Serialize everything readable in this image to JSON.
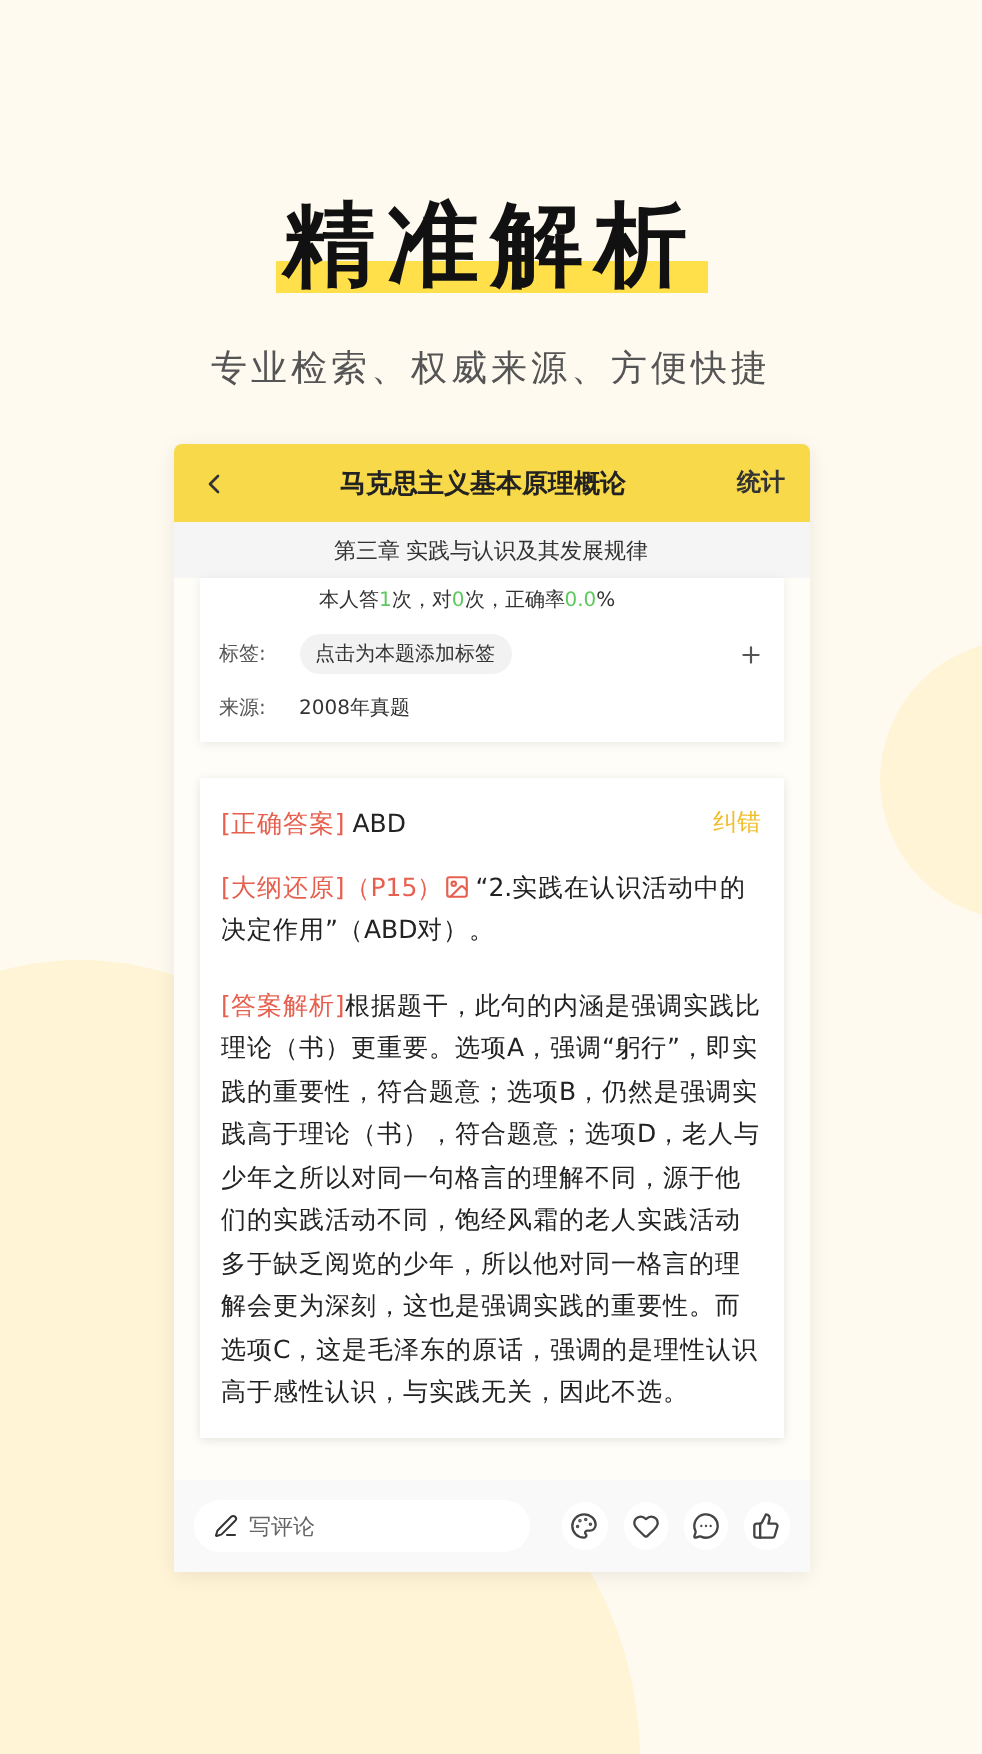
{
  "headline": "精准解析",
  "subtitle": "专业检索、权威来源、方便快捷",
  "header": {
    "title": "马克思主义基本原理概论",
    "action": "统计"
  },
  "chapter": "第三章 实践与认识及其发展规律",
  "stats": [
    {
      "text": "本人答",
      "highlight": false
    },
    {
      "text": "1",
      "highlight": true
    },
    {
      "text": "次，对",
      "highlight": false
    },
    {
      "text": "0",
      "highlight": true
    },
    {
      "text": "次，正确率",
      "highlight": false
    },
    {
      "text": "0.0",
      "highlight": true
    },
    {
      "text": "%",
      "highlight": false
    }
  ],
  "tag_row": {
    "label": "标签:",
    "chip": "点击为本题添加标签"
  },
  "source_row": {
    "label": "来源:",
    "value": "2008年真题"
  },
  "answer": {
    "label": "[正确答案]",
    "value": "ABD",
    "action": "纠错"
  },
  "outline": {
    "label": "[大纲还原]",
    "page": "（P15）",
    "text": "“2.实践在认识活动中的决定作用”（ABD对）。"
  },
  "analysis": {
    "label": "[答案解析]",
    "text": "根据题干，此句的内涵是强调实践比理论（书）更重要。选项A，强调“躬行”，即实践的重要性，符合题意；选项B，仍然是强调实践高于理论（书），符合题意；选项D，老人与少年之所以对同一句格言的理解不同，源于他们的实践活动不同，饱经风霜的老人实践活动多于缺乏阅览的少年，所以他对同一格言的理解会更为深刻，这也是强调实践的重要性。而选项C，这是毛泽东的原话，强调的是理性认识高于感性认识，与实践无关，因此不选。"
  },
  "comment": {
    "placeholder": "写评论"
  }
}
